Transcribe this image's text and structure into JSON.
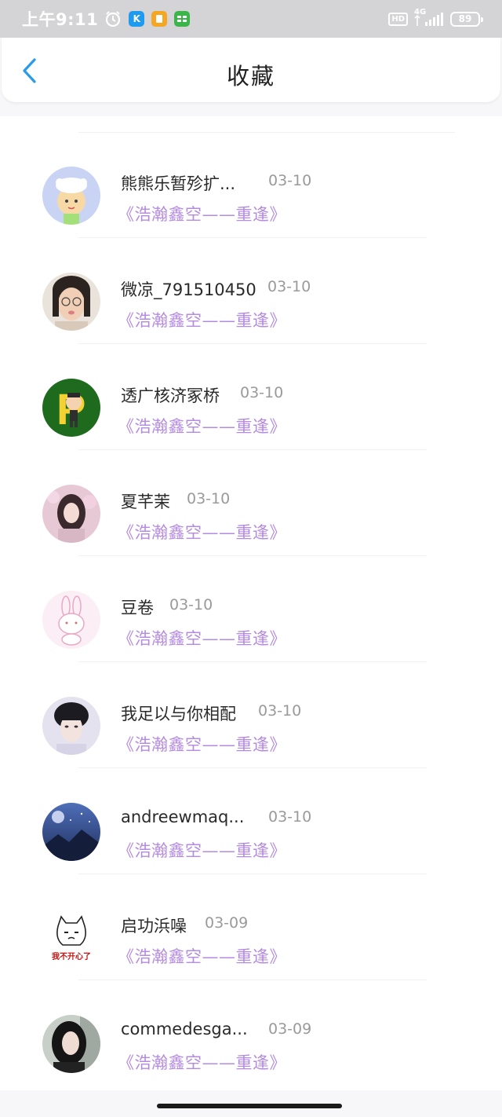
{
  "status_bar": {
    "time": "上午9:11",
    "hd": "HD",
    "network": "4G",
    "battery": "89"
  },
  "header": {
    "title": "收藏"
  },
  "items": [
    {
      "name": "熊熊乐暂殄扩...",
      "date": "03-10",
      "title": "《浩瀚鑫空——重逢》",
      "avatar_icon": "cartoon-cow-avatar"
    },
    {
      "name": "微凉_791510450",
      "date": "03-10",
      "title": "《浩瀚鑫空——重逢》",
      "avatar_icon": "girl-photo-avatar"
    },
    {
      "name": "透广核济冢桥",
      "date": "03-10",
      "title": "《浩瀚鑫空——重逢》",
      "avatar_icon": "letter-p-avatar"
    },
    {
      "name": "夏芊茉",
      "date": "03-10",
      "title": "《浩瀚鑫空——重逢》",
      "avatar_icon": "pink-girl-avatar"
    },
    {
      "name": "豆卷",
      "date": "03-10",
      "title": "《浩瀚鑫空——重逢》",
      "avatar_icon": "bunny-sketch-avatar"
    },
    {
      "name": "我足以与你相配",
      "date": "03-10",
      "title": "《浩瀚鑫空——重逢》",
      "avatar_icon": "boy-photo-avatar"
    },
    {
      "name": "andreewmaq...",
      "date": "03-10",
      "title": "《浩瀚鑫空——重逢》",
      "avatar_icon": "night-sky-avatar"
    },
    {
      "name": "启功浜噪",
      "date": "03-09",
      "title": "《浩瀚鑫空——重逢》",
      "avatar_icon": "unhappy-cat-avatar",
      "avatar_caption": "我不开心了"
    },
    {
      "name": "commedesga...",
      "date": "03-09",
      "title": "《浩瀚鑫空——重逢》",
      "avatar_icon": "dark-hair-girl-avatar"
    }
  ],
  "colors": {
    "accent_back": "#2a9be8",
    "work_title": "#b48be0",
    "date": "#9a9a9a"
  }
}
